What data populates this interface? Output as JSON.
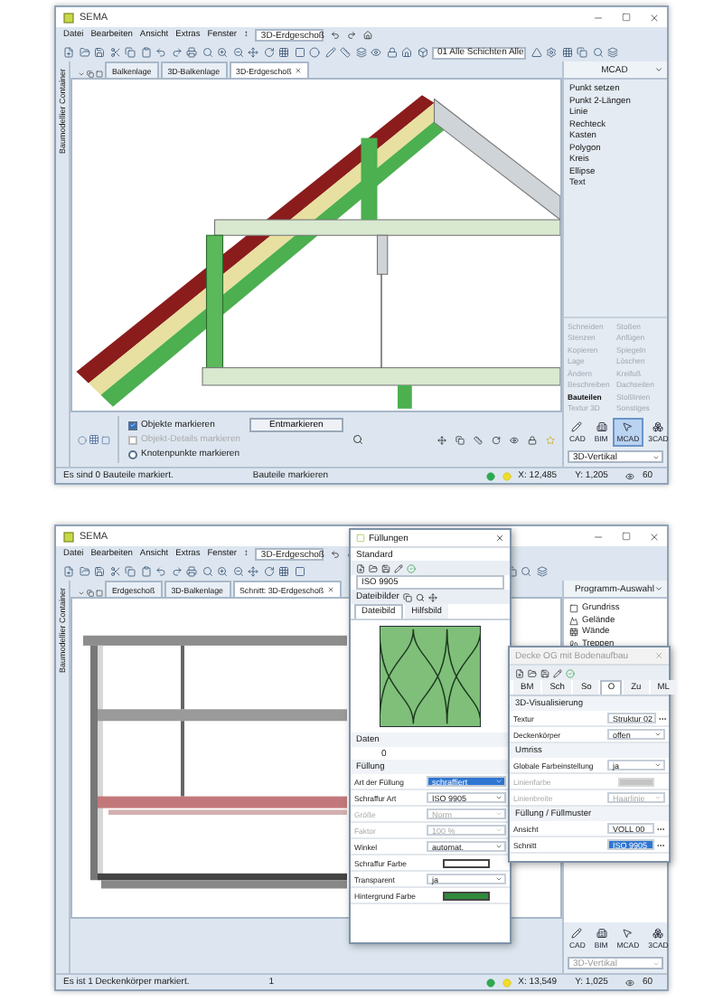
{
  "windows": [
    {
      "title": "SEMA",
      "menu": [
        "Datei",
        "Bearbeiten",
        "Ansicht",
        "Extras",
        "Fenster",
        "↕"
      ],
      "view_select": "3D-Erdgeschoß",
      "layer_select": "01 Alle Schichten Alle",
      "side_strip": "Baumodellier Container",
      "tabs": [
        {
          "label": "Balkenlage",
          "selected": false
        },
        {
          "label": "3D-Balkenlage",
          "selected": false
        },
        {
          "label": "3D-Erdgeschoß",
          "selected": true
        }
      ],
      "canvas": {
        "kind": "roof"
      },
      "panel": {
        "kind": "tools",
        "header": "MCAD",
        "items": [
          "Punkt setzen",
          "Punkt 2-Längen",
          "Linie",
          "Rechteck",
          "Kasten",
          "Polygon",
          "Kreis",
          "Ellipse",
          "Text"
        ],
        "options": [
          {
            "label": "Schneiden",
            "enabled": false
          },
          {
            "label": "Stoßen",
            "enabled": false
          },
          {
            "label": "Stenzen",
            "enabled": false
          },
          {
            "label": "Anfügen",
            "enabled": false
          },
          {
            "label": "Kopieren",
            "enabled": false
          },
          {
            "label": "Spiegeln",
            "enabled": false
          },
          {
            "label": "Lage",
            "enabled": false
          },
          {
            "label": "Löschen",
            "enabled": false
          },
          {
            "label": "Ändern",
            "enabled": false
          },
          {
            "label": "Kreifuß",
            "enabled": false
          },
          {
            "label": "Beschreiben",
            "enabled": false
          },
          {
            "label": "Dachseiten",
            "enabled": false
          },
          {
            "label": "Bauteilen",
            "enabled": true
          },
          {
            "label": "Stoßlinien",
            "enabled": false
          },
          {
            "label": "Textur 3D",
            "enabled": false
          },
          {
            "label": "Sonstiges",
            "enabled": false
          }
        ],
        "modes": [
          {
            "label": "CAD",
            "selected": false
          },
          {
            "label": "BIM",
            "selected": false
          },
          {
            "label": "MCAD",
            "selected": true
          },
          {
            "label": "3CAD",
            "selected": false
          }
        ],
        "view_mode": {
          "value": "3D-Vertikal",
          "disabled": false
        }
      },
      "mark_options": [
        {
          "kind": "checkbox",
          "label": "Objekte markieren",
          "checked": true,
          "disabled": false
        },
        {
          "kind": "checkbox",
          "label": "Objekt-Details markieren",
          "checked": false,
          "disabled": true
        },
        {
          "kind": "radio",
          "label": "Knotenpunkte markieren",
          "checked": false,
          "disabled": false
        }
      ],
      "unmark_button": "Entmarkieren",
      "status": {
        "message": "Es sind 0 Bauteile markiert.",
        "hint": "Bauteile markieren",
        "x": "X: 12,485",
        "y": "Y: 1,205",
        "zoom": "60"
      }
    },
    {
      "title": "SEMA",
      "menu": [
        "Datei",
        "Bearbeiten",
        "Ansicht",
        "Extras",
        "Fenster",
        "↕"
      ],
      "view_select": "3D-Erdgeschoß",
      "side_strip": "Baumodellier Container",
      "tabs": [
        {
          "label": "Erdgeschoß",
          "selected": false
        },
        {
          "label": "3D-Balkenlage",
          "selected": false
        },
        {
          "label": "Schnitt: 3D-Erdgeschoß",
          "selected": true
        }
      ],
      "canvas": {
        "kind": "section"
      },
      "panel": {
        "kind": "programs",
        "header": "Programm-Auswahl",
        "items": [
          "Grundriss",
          "Gelände",
          "Wände",
          "Treppen"
        ],
        "modes": [
          {
            "label": "CAD",
            "selected": false
          },
          {
            "label": "BIM",
            "selected": false
          },
          {
            "label": "MCAD",
            "selected": false
          },
          {
            "label": "3CAD",
            "selected": false
          }
        ],
        "view_mode": {
          "value": "3D-Vertikal",
          "disabled": true
        }
      },
      "status": {
        "message": "Es ist 1 Deckenkörper markiert.",
        "hint": "1",
        "x": "X: 13,549",
        "y": "Y: 1,025",
        "zoom": "60"
      },
      "dialogs": [
        {
          "kind": "fill",
          "title": "Füllungen",
          "active": true,
          "preset": "Standard",
          "name_field": "ISO 9905",
          "gallery_label": "Dateibilder",
          "tabs": [
            {
              "label": "Dateibild",
              "selected": true
            },
            {
              "label": "Hilfsbild",
              "selected": false
            }
          ],
          "data_label": "Daten",
          "data_value": "0",
          "sections": [
            {
              "title": "Füllung",
              "rows": [
                {
                  "label": "Art der Füllung",
                  "value": "schraffiert",
                  "kind": "select",
                  "selected": true,
                  "disabled": false
                },
                {
                  "label": "Schraffur Art",
                  "value": "ISO 9905",
                  "kind": "select",
                  "selected": false,
                  "disabled": false
                },
                {
                  "label": "Größe",
                  "value": "Norm",
                  "kind": "select",
                  "selected": false,
                  "disabled": true
                },
                {
                  "label": "Faktor",
                  "value": "100 %",
                  "kind": "select",
                  "selected": false,
                  "disabled": true
                },
                {
                  "label": "Winkel",
                  "value": "automat.",
                  "kind": "select",
                  "selected": false,
                  "disabled": false
                },
                {
                  "label": "Schraffur Farbe",
                  "kind": "swatch",
                  "color": "#ffffff",
                  "selected": false,
                  "disabled": false
                },
                {
                  "label": "Transparent",
                  "value": "ja",
                  "kind": "select",
                  "selected": false,
                  "disabled": false
                },
                {
                  "label": "Hintergrund Farbe",
                  "kind": "swatch",
                  "color": "#2f8a3a",
                  "selected": false,
                  "disabled": false
                }
              ]
            }
          ]
        },
        {
          "kind": "properties",
          "title": "Decke OG mit Bodenaufbau",
          "active": false,
          "tabs": [
            {
              "label": "BM",
              "selected": false
            },
            {
              "label": "Sch",
              "selected": false
            },
            {
              "label": "So",
              "selected": false
            },
            {
              "label": "O",
              "selected": true
            },
            {
              "label": "Zu",
              "selected": false
            },
            {
              "label": "ML",
              "selected": false
            }
          ],
          "sections": [
            {
              "title": "3D-Visualisierung",
              "rows": [
                {
                  "label": "Textur",
                  "value": "Struktur 02",
                  "kind": "browse",
                  "selected": false,
                  "disabled": false
                },
                {
                  "label": "Deckenkörper",
                  "value": "offen",
                  "kind": "select",
                  "selected": false,
                  "disabled": false
                }
              ]
            },
            {
              "title": "Umriss",
              "rows": [
                {
                  "label": "Globale Farbeinstellung",
                  "value": "ja",
                  "kind": "select",
                  "selected": false,
                  "disabled": false
                },
                {
                  "label": "Linienfarbe",
                  "kind": "swatch",
                  "color": "#c4c4c4",
                  "selected": false,
                  "disabled": true
                },
                {
                  "label": "Linienbreite",
                  "value": "Haarlinie",
                  "kind": "select",
                  "selected": false,
                  "disabled": true
                }
              ]
            },
            {
              "title": "Füllung / Füllmuster",
              "rows": [
                {
                  "label": "Ansicht",
                  "value": "VOLL 00",
                  "kind": "browse",
                  "selected": false,
                  "disabled": false
                },
                {
                  "label": "Schnitt",
                  "value": "ISO 9905",
                  "kind": "browse",
                  "selected": true,
                  "disabled": false
                }
              ]
            }
          ]
        }
      ]
    }
  ]
}
